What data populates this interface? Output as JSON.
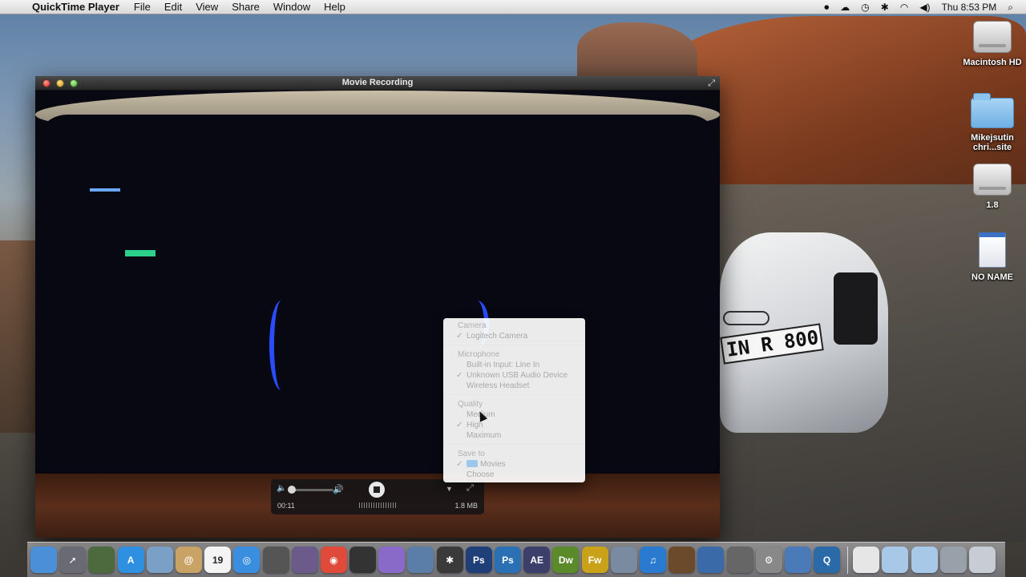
{
  "menubar": {
    "app_name": "QuickTime Player",
    "menus": [
      "File",
      "Edit",
      "View",
      "Share",
      "Window",
      "Help"
    ],
    "clock": "Thu 8:53 PM"
  },
  "desktop": {
    "icons": [
      {
        "label": "Macintosh HD",
        "kind": "drive"
      },
      {
        "label": "Mikejsutin chri...site",
        "kind": "folder"
      },
      {
        "label": "1.8",
        "kind": "drive"
      },
      {
        "label": "NO NAME",
        "kind": "sdcard"
      }
    ],
    "plate_text": "IN R 800"
  },
  "window": {
    "title": "Movie Recording"
  },
  "popup": {
    "camera_heading": "Camera",
    "camera_items": [
      "Logitech Camera"
    ],
    "camera_selected": 0,
    "microphone_heading": "Microphone",
    "microphone_items": [
      "Built-in Input: Line In",
      "Unknown USB Audio Device",
      "Wireless Headset"
    ],
    "microphone_selected": 1,
    "quality_heading": "Quality",
    "quality_items": [
      "Medium",
      "High",
      "Maximum"
    ],
    "quality_selected": 1,
    "save_heading": "Save to",
    "save_items": [
      "Movies",
      "Choose"
    ],
    "save_selected": 0,
    "check": "✓"
  },
  "hud": {
    "elapsed": "00:11",
    "file_size": "1.8 MB"
  },
  "dock": {
    "apps": [
      {
        "name": "finder",
        "color": "#4a8fd8",
        "glyph": ""
      },
      {
        "name": "launchpad",
        "color": "#6a6a74",
        "glyph": "➚"
      },
      {
        "name": "mission-control",
        "color": "#4c6a3e",
        "glyph": ""
      },
      {
        "name": "app-store",
        "color": "#2f8fe0",
        "glyph": "A"
      },
      {
        "name": "preview",
        "color": "#7aa0c8",
        "glyph": ""
      },
      {
        "name": "contacts",
        "color": "#c9a266",
        "glyph": "@"
      },
      {
        "name": "calendar",
        "color": "#f4f4f4",
        "glyph": "19"
      },
      {
        "name": "safari",
        "color": "#3a8ee0",
        "glyph": "◎"
      },
      {
        "name": "facetime",
        "color": "#555",
        "glyph": ""
      },
      {
        "name": "pixelmator",
        "color": "#6b5a8a",
        "glyph": ""
      },
      {
        "name": "chrome",
        "color": "#e04a3a",
        "glyph": "◉"
      },
      {
        "name": "final-cut",
        "color": "#333",
        "glyph": ""
      },
      {
        "name": "motion",
        "color": "#8a6ac8",
        "glyph": ""
      },
      {
        "name": "imovie",
        "color": "#5b7ea8",
        "glyph": ""
      },
      {
        "name": "compressor",
        "color": "#3a3a3a",
        "glyph": "✱"
      },
      {
        "name": "photoshop",
        "color": "#1f3f78",
        "glyph": "Ps"
      },
      {
        "name": "photoshop-cc",
        "color": "#2b6fb4",
        "glyph": "Ps"
      },
      {
        "name": "after-effects",
        "color": "#3b3f6a",
        "glyph": "AE"
      },
      {
        "name": "dreamweaver",
        "color": "#5b8a2a",
        "glyph": "Dw"
      },
      {
        "name": "fireworks",
        "color": "#c9a21a",
        "glyph": "Fw"
      },
      {
        "name": "iphoto",
        "color": "#7a8aa0",
        "glyph": ""
      },
      {
        "name": "itunes",
        "color": "#2a7ad0",
        "glyph": "♫"
      },
      {
        "name": "garageband",
        "color": "#6a4a2a",
        "glyph": ""
      },
      {
        "name": "xcode",
        "color": "#3a6aa8",
        "glyph": ""
      },
      {
        "name": "utilities",
        "color": "#666",
        "glyph": ""
      },
      {
        "name": "system-preferences",
        "color": "#888",
        "glyph": "⚙"
      },
      {
        "name": "mail",
        "color": "#4a7ab8",
        "glyph": ""
      },
      {
        "name": "quicktime",
        "color": "#2a6aa8",
        "glyph": "Q"
      }
    ],
    "stacks": [
      {
        "name": "documents-stack",
        "color": "#e6e6e6"
      },
      {
        "name": "downloads-stack",
        "color": "#a8c8e8"
      },
      {
        "name": "applications-stack",
        "color": "#a8c8e8"
      },
      {
        "name": "network-stack",
        "color": "#9aa0aa"
      },
      {
        "name": "trash",
        "color": "#c8ccd4"
      }
    ]
  }
}
